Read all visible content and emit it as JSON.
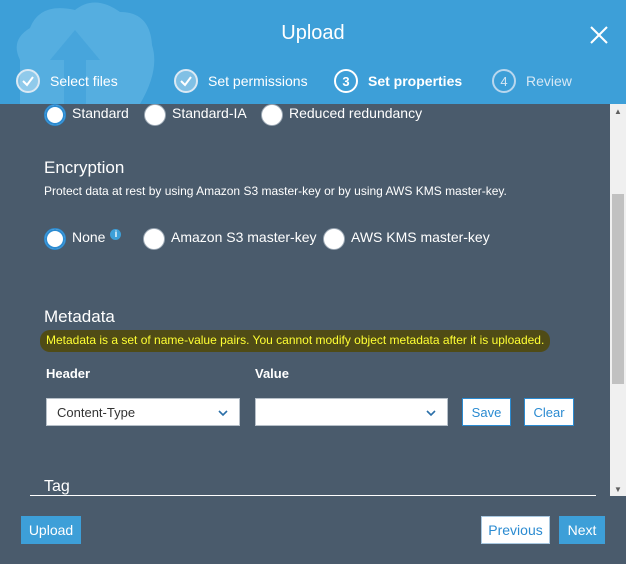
{
  "dialog": {
    "title": "Upload",
    "steps": [
      {
        "number": "1",
        "label": "Select files",
        "state": "done"
      },
      {
        "number": "2",
        "label": "Set permissions",
        "state": "done"
      },
      {
        "number": "3",
        "label": "Set properties",
        "state": "current"
      },
      {
        "number": "4",
        "label": "Review",
        "state": "future"
      }
    ]
  },
  "storage_class": {
    "options": [
      "Standard",
      "Standard-IA",
      "Reduced redundancy"
    ],
    "selected": "Standard"
  },
  "encryption": {
    "title": "Encryption",
    "description": "Protect data at rest by using Amazon S3 master-key or by using AWS KMS master-key.",
    "options": [
      "None",
      "Amazon S3 master-key",
      "AWS KMS master-key"
    ],
    "selected": "None"
  },
  "metadata": {
    "title": "Metadata",
    "description": "Metadata is a set of name-value pairs. You cannot modify object metadata after it is uploaded.",
    "header_label": "Header",
    "value_label": "Value",
    "header_selected": "Content-Type",
    "value_selected": "",
    "save_label": "Save",
    "clear_label": "Clear"
  },
  "tag": {
    "title": "Tag"
  },
  "footer": {
    "upload_label": "Upload",
    "previous_label": "Previous",
    "next_label": "Next"
  },
  "colors": {
    "header_bg": "#3d9fd8",
    "body_bg": "#4a5b6c",
    "highlight_bg": "#4f4b16",
    "highlight_text": "#ffff33",
    "accent": "#2b8bd1"
  },
  "icons": {
    "close": "close-icon",
    "check": "check-icon",
    "info": "info-icon",
    "chevron": "chevron-down-icon",
    "cloud": "cloud-upload-icon"
  }
}
